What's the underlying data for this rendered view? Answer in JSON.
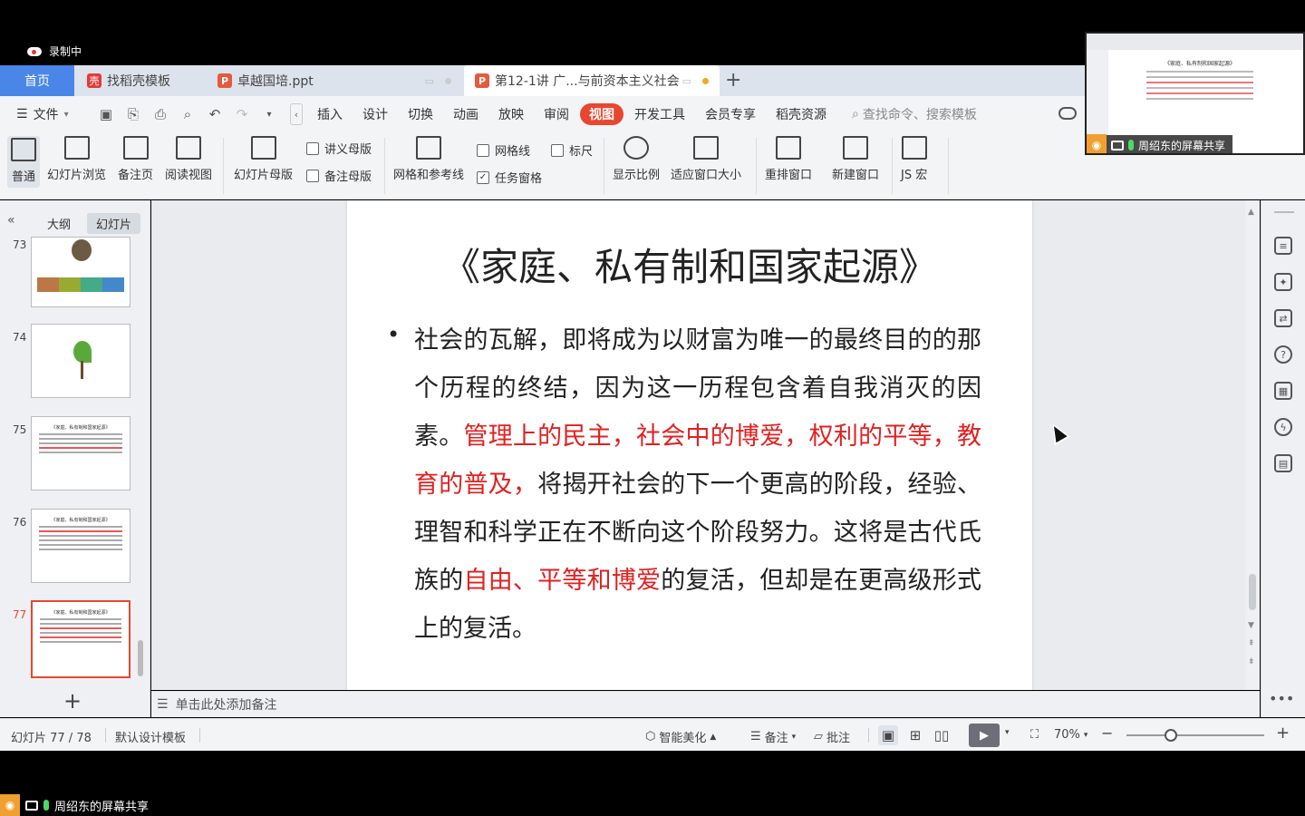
{
  "recording": {
    "label": "录制中"
  },
  "tabs": [
    {
      "label": "首页"
    },
    {
      "label": "找稻壳模板"
    },
    {
      "label": "卓越国培.ppt"
    },
    {
      "label": "第12-1讲 广...与前资本主义社会"
    }
  ],
  "menubar": {
    "file": "文件",
    "items": [
      "插入",
      "设计",
      "切换",
      "动画",
      "放映",
      "审阅",
      "视图",
      "开发工具",
      "会员专享",
      "稻壳资源"
    ],
    "active": "视图",
    "search_placeholder": "查找命令、搜索模板"
  },
  "ribbon": {
    "normal": "普通",
    "slide_browse": "幻灯片浏览",
    "notes_page": "备注页",
    "reading_view": "阅读视图",
    "slide_master": "幻灯片母版",
    "handout_master": "讲义母版",
    "notes_master": "备注母版",
    "grid_guides": "网格和参考线",
    "gridlines": "网格线",
    "ruler": "标尺",
    "task_pane": "任务窗格",
    "zoom": "显示比例",
    "fit_window": "适应窗口大小",
    "arrange": "重排窗口",
    "new_window": "新建窗口",
    "js_macro": "JS 宏"
  },
  "left_panel": {
    "tab_outline": "大纲",
    "tab_slides": "幻灯片",
    "slides": [
      {
        "num": "73"
      },
      {
        "num": "74"
      },
      {
        "num": "75",
        "title": "《家庭、私有制和国家起源》"
      },
      {
        "num": "76",
        "title": "《家庭、私有制和国家起源》"
      },
      {
        "num": "77",
        "title": "《家庭、私有制和国家起源》"
      }
    ]
  },
  "slide": {
    "title": "《家庭、私有制和国家起源》",
    "bullet": "•",
    "seg1": "社会的瓦解，即将成为以财富为唯一的最终目的的那个历程的终结，因为这一历程包含着自我消灭的因素。",
    "seg2_red": "管理上的民主，社会中的博爱，权利的平等，教育的普及，",
    "seg3": "将揭开社会的下一个更高的阶段，经验、理智和科学正在不断向这个阶段努力。这将是古代氏族的",
    "seg4_red": "自由、平等和博爱",
    "seg5": "的复活，但却是在更高级形式上的复活。"
  },
  "notes": {
    "placeholder": "单击此处添加备注"
  },
  "status": {
    "slide_count": "幻灯片 77 / 78",
    "template": "默认设计模板",
    "smart_beautify": "智能美化",
    "notes": "备注",
    "comments": "批注",
    "zoom": "70%"
  },
  "share": {
    "label": "周绍东的屏幕共享"
  },
  "preview": {
    "title": "《家庭、私有制和国家起源》",
    "share_label": "周绍东的屏幕共享"
  },
  "colors": {
    "accent": "#e8472f",
    "home_tab": "#4a86e8",
    "red_text": "#e02020"
  }
}
